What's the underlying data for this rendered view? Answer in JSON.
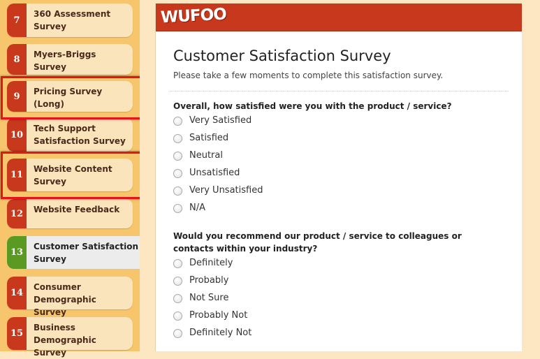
{
  "brand": {
    "logo_text": "WUFOO",
    "color": "#c8381c"
  },
  "sidebar": {
    "items": [
      {
        "number": "7",
        "label": "360 Assessment Survey"
      },
      {
        "number": "8",
        "label": "Myers-Briggs Survey"
      },
      {
        "number": "9",
        "label": "Pricing Survey (Long)"
      },
      {
        "number": "10",
        "label": "Tech Support Satisfaction Survey"
      },
      {
        "number": "11",
        "label": "Website Content Survey"
      },
      {
        "number": "12",
        "label": "Website Feedback"
      },
      {
        "number": "13",
        "label": "Customer Satisfaction Survey"
      },
      {
        "number": "14",
        "label": "Consumer Demographic Survey"
      },
      {
        "number": "15",
        "label": "Business Demographic Survey"
      }
    ],
    "active_item": "13",
    "highlighted_items": [
      "9",
      "11"
    ],
    "active_color": "#5a9a22",
    "highlight_color": "#e3141b"
  },
  "form": {
    "title": "Customer Satisfaction Survey",
    "description": "Please take a few moments to complete this satisfaction survey.",
    "questions": [
      {
        "label": "Overall, how satisfied were you with the product / service?",
        "options": [
          "Very Satisfied",
          "Satisfied",
          "Neutral",
          "Unsatisfied",
          "Very Unsatisfied",
          "N/A"
        ]
      },
      {
        "label": "Would you recommend our product / service to colleagues or contacts within your industry?",
        "options": [
          "Definitely",
          "Probably",
          "Not Sure",
          "Probably Not",
          "Definitely Not"
        ]
      }
    ]
  }
}
